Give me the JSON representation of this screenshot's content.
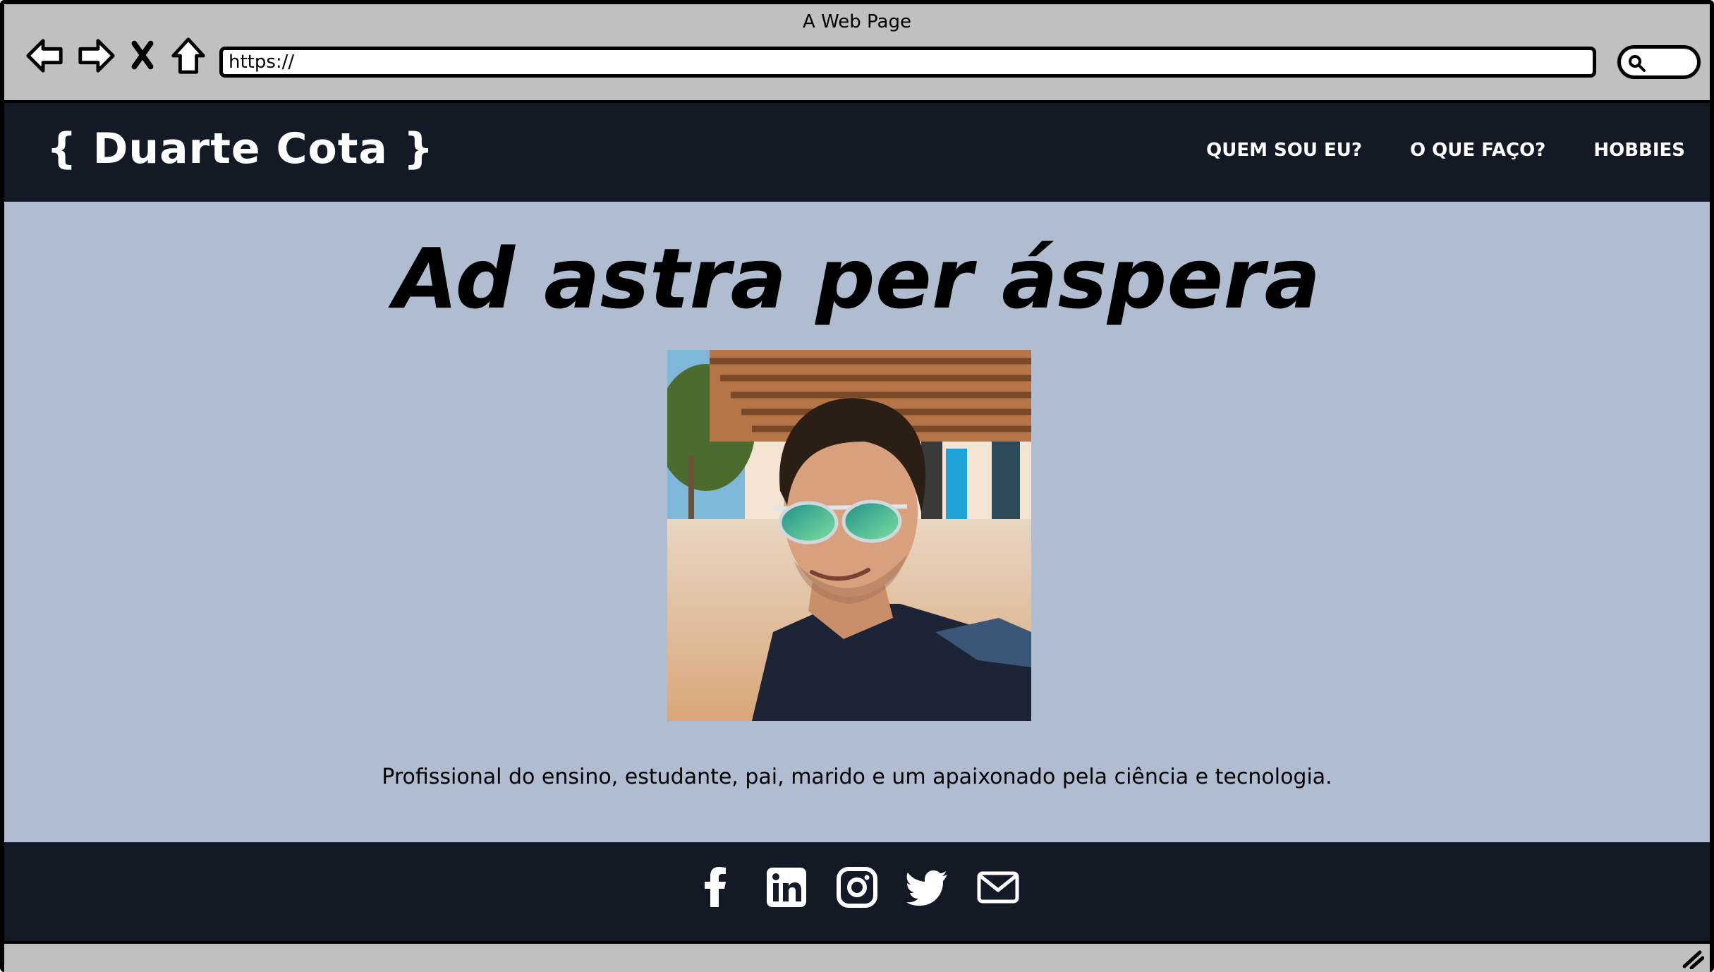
{
  "browser": {
    "window_title": "A Web Page",
    "url": "https://",
    "icons": [
      "back-arrow-icon",
      "forward-arrow-icon",
      "close-x-icon",
      "home-icon",
      "search-icon",
      "resize-grip-icon"
    ]
  },
  "header": {
    "brand": "{ Duarte Cota }",
    "menu": [
      {
        "label": "QUEM SOU EU?"
      },
      {
        "label": "O QUE FAÇO?"
      },
      {
        "label": "HOBBIES"
      }
    ]
  },
  "main": {
    "motto": "Ad astra per áspera",
    "tagline": "Profissional do ensino, estudante, pai, marido e um apaixonado pela ciência e tecnologia."
  },
  "footer": {
    "social_icons": [
      "facebook-icon",
      "linkedin-icon",
      "instagram-icon",
      "twitter-icon",
      "email-icon"
    ]
  },
  "colors": {
    "dark_bar": "#141a25",
    "content_bg": "#b0bdd1",
    "chrome": "#c0c0c0"
  }
}
